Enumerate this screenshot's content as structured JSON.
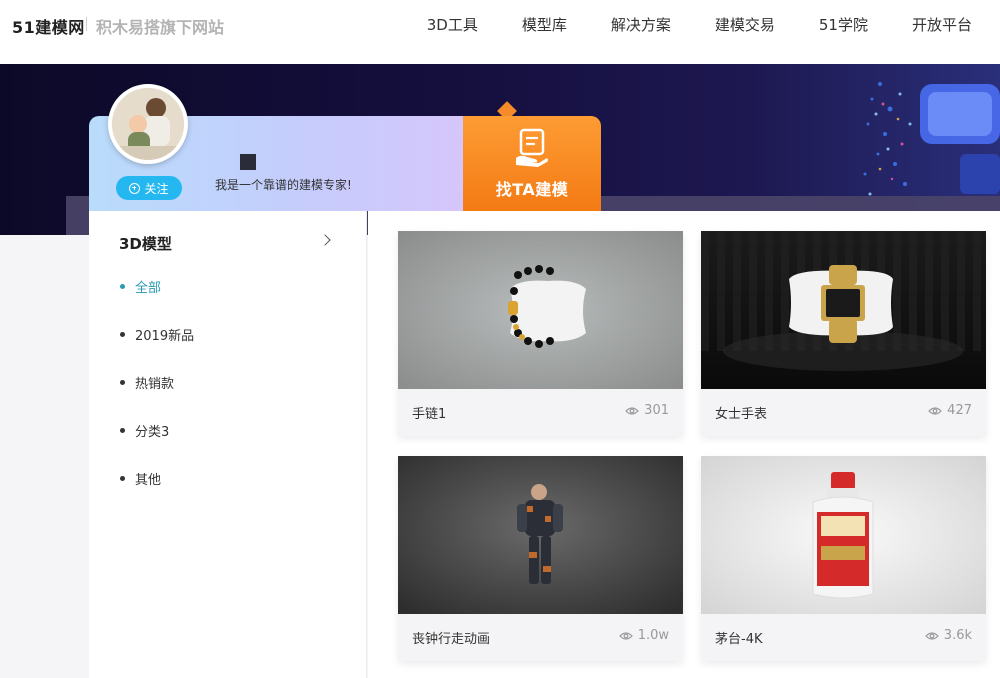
{
  "header": {
    "brand": "51建模网",
    "brand_sub": "积木易搭旗下网站",
    "nav": [
      "3D工具",
      "模型库",
      "解决方案",
      "建模交易",
      "51学院",
      "开放平台"
    ]
  },
  "profile": {
    "follow_label": "关注",
    "bio": "我是一个靠谱的建模专家!",
    "hire_label": "找TA建模"
  },
  "sidebar": {
    "title": "3D模型",
    "categories": [
      "全部",
      "2019新品",
      "热销款",
      "分类3",
      "其他"
    ],
    "active_index": 0
  },
  "models": [
    {
      "name": "手链1",
      "views": "301"
    },
    {
      "name": "女士手表",
      "views": "427"
    },
    {
      "name": "丧钟行走动画",
      "views": "1.0w"
    },
    {
      "name": "茅台-4K",
      "views": "3.6k"
    }
  ],
  "colors": {
    "accent_orange": "#f47a14",
    "follow_blue": "#25b8f0",
    "active_teal": "#2a9bb4",
    "banner_dark": "#0c0928"
  }
}
